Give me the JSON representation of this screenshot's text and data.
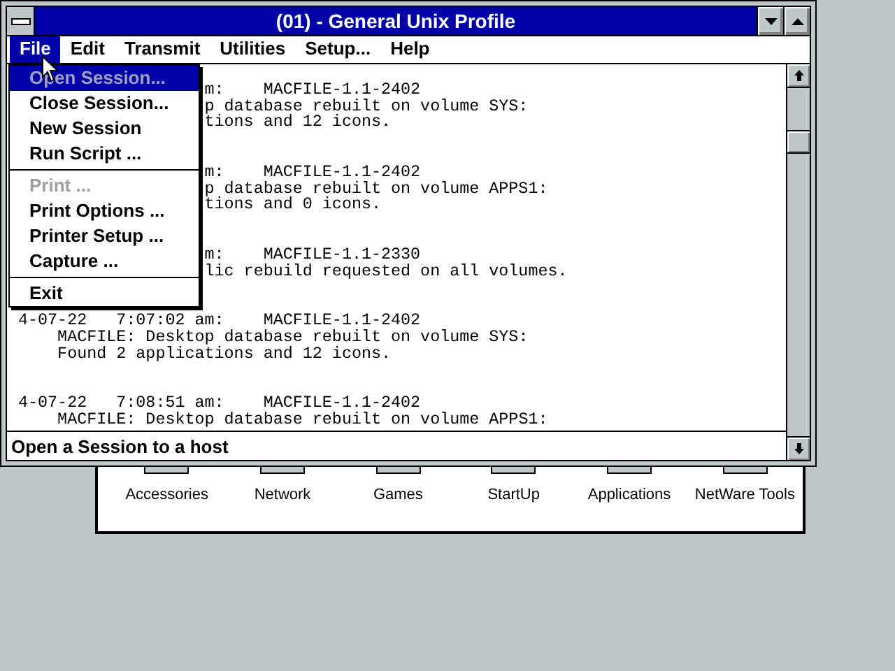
{
  "window": {
    "title": "(01) - General Unix Profile"
  },
  "menu_bar": [
    {
      "label": "File",
      "selected": true
    },
    {
      "label": "Edit",
      "selected": false
    },
    {
      "label": "Transmit",
      "selected": false
    },
    {
      "label": "Utilities",
      "selected": false
    },
    {
      "label": "Setup...",
      "selected": false
    },
    {
      "label": "Help",
      "selected": false
    }
  ],
  "file_menu": [
    {
      "kind": "item",
      "label": "Open Session...",
      "selected": true,
      "disabled": true
    },
    {
      "kind": "item",
      "label": "Close Session...",
      "selected": false,
      "disabled": false
    },
    {
      "kind": "item",
      "label": "New Session",
      "selected": false,
      "disabled": false
    },
    {
      "kind": "item",
      "label": "Run Script ...",
      "selected": false,
      "disabled": false
    },
    {
      "kind": "separator"
    },
    {
      "kind": "item",
      "label": "Print ...",
      "selected": false,
      "disabled": true
    },
    {
      "kind": "item",
      "label": "Print Options ...",
      "selected": false,
      "disabled": false
    },
    {
      "kind": "item",
      "label": "Printer Setup ...",
      "selected": false,
      "disabled": false
    },
    {
      "kind": "item",
      "label": "Capture ...",
      "selected": false,
      "disabled": false
    },
    {
      "kind": "separator"
    },
    {
      "kind": "item",
      "label": "Exit",
      "selected": false,
      "disabled": false
    }
  ],
  "terminal_lines": [
    {
      "kind": "blank"
    },
    {
      "kind": "partial",
      "text": "m:    MACFILE-1.1-2402"
    },
    {
      "kind": "partial",
      "text": "p database rebuilt on volume SYS:"
    },
    {
      "kind": "partial",
      "text": "tions and 12 icons."
    },
    {
      "kind": "blank"
    },
    {
      "kind": "blank"
    },
    {
      "kind": "partial",
      "text": "m:    MACFILE-1.1-2402"
    },
    {
      "kind": "partial",
      "text": "p database rebuilt on volume APPS1:"
    },
    {
      "kind": "partial",
      "text": "tions and 0 icons."
    },
    {
      "kind": "blank"
    },
    {
      "kind": "blank"
    },
    {
      "kind": "partial",
      "text": "m:    MACFILE-1.1-2330"
    },
    {
      "kind": "partial",
      "text": "lic rebuild requested on all volumes."
    },
    {
      "kind": "blank"
    },
    {
      "kind": "blank"
    },
    {
      "kind": "full",
      "text": "4-07-22   7:07:02 am:    MACFILE-1.1-2402"
    },
    {
      "kind": "full",
      "text": "    MACFILE: Desktop database rebuilt on volume SYS:"
    },
    {
      "kind": "full",
      "text": "    Found 2 applications and 12 icons."
    },
    {
      "kind": "blank"
    },
    {
      "kind": "blank"
    },
    {
      "kind": "full",
      "text": "4-07-22   7:08:51 am:    MACFILE-1.1-2402"
    },
    {
      "kind": "full",
      "text": "    MACFILE: Desktop database rebuilt on volume APPS1:"
    }
  ],
  "status_bar": "Open a Session to a host",
  "program_group": {
    "items": [
      "Accessories",
      "Network",
      "Games",
      "StartUp",
      "Applications",
      "NetWare Tools"
    ]
  }
}
